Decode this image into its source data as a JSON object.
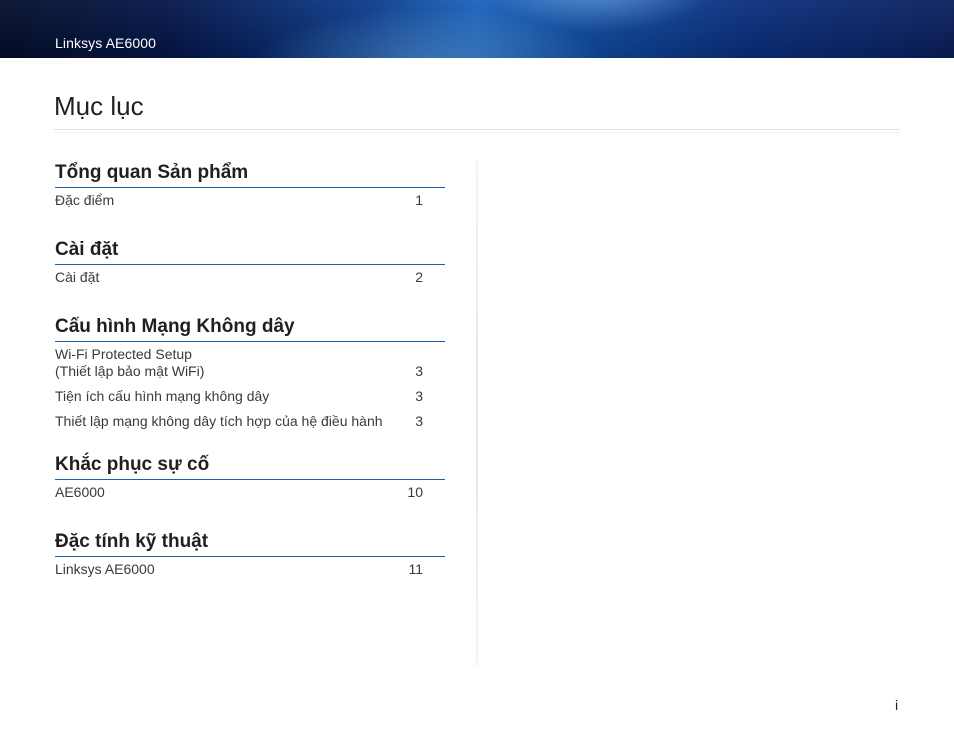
{
  "header": {
    "title": "Linksys AE6000"
  },
  "page": {
    "title": "Mục lục",
    "footer_number": "i"
  },
  "toc": [
    {
      "heading": "Tổng quan Sản phẩm",
      "entries": [
        {
          "text": "Đặc điểm",
          "page": "1"
        }
      ]
    },
    {
      "heading": "Cài đặt",
      "entries": [
        {
          "text": "Cài đặt",
          "page": "2"
        }
      ]
    },
    {
      "heading": "Cấu hình Mạng Không dây",
      "entries": [
        {
          "text": "Wi-Fi Protected Setup",
          "text2": "(Thiết lập bảo mật WiFi)",
          "page": "3"
        },
        {
          "text": "Tiện ích cấu hình mạng không dây",
          "page": "3"
        },
        {
          "text": "Thiết lập mạng không dây tích hợp của hệ điều hành",
          "page": "3"
        }
      ]
    },
    {
      "heading": "Khắc phục sự cố",
      "entries": [
        {
          "text": "AE6000",
          "page": "10"
        }
      ]
    },
    {
      "heading": "Đặc tính kỹ thuật",
      "entries": [
        {
          "text": "Linksys AE6000",
          "page": "11"
        }
      ]
    }
  ]
}
